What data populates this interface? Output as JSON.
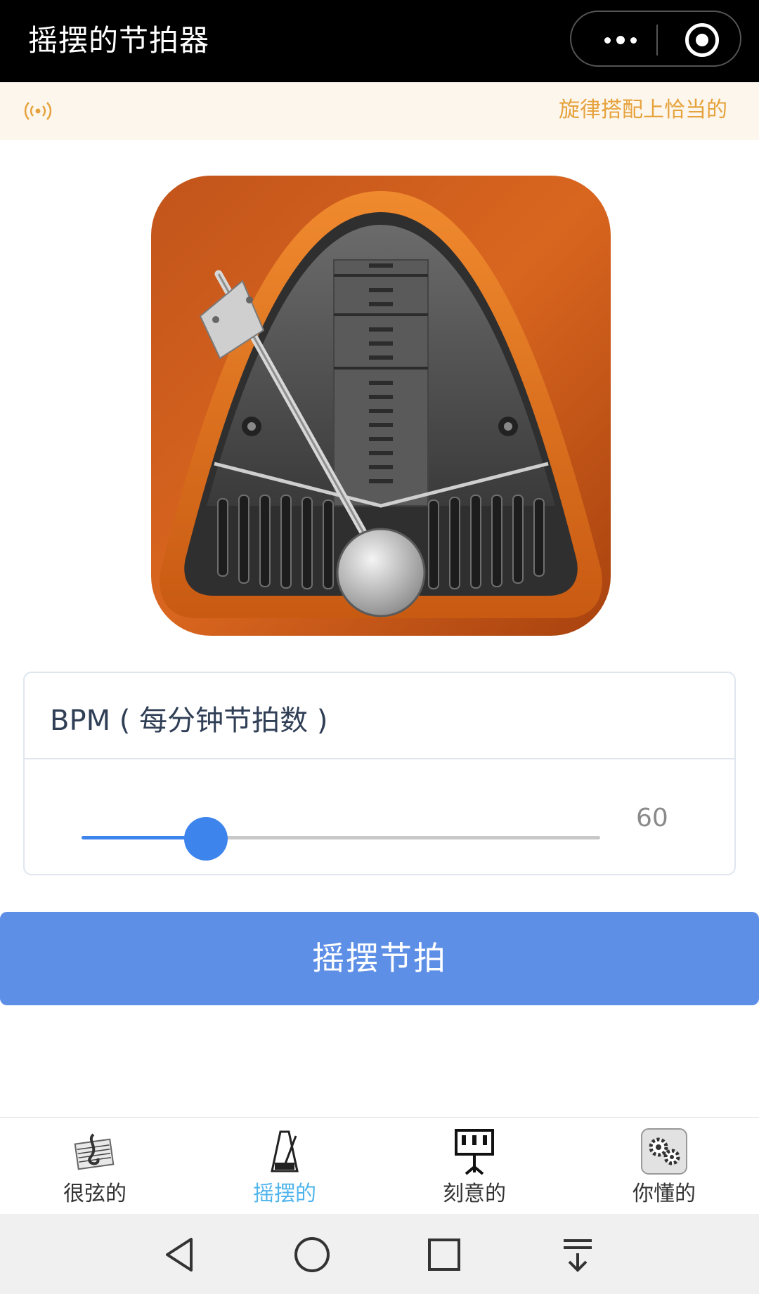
{
  "header": {
    "title": "摇摆的节拍器",
    "more_icon": "more-dots-icon",
    "close_icon": "target-circle-icon"
  },
  "notice": {
    "icon": "broadcast-icon",
    "text": "旋律搭配上恰当的",
    "color": "#e6a23c"
  },
  "hero": {
    "image": "metronome-app-icon"
  },
  "bpm": {
    "label": "BPM ( 每分钟节拍数 )",
    "value": "60",
    "slider_fraction": 0.24,
    "accent": "#3e84ed"
  },
  "primary_button": {
    "label": "摇摆节拍",
    "color": "#5e8fe6"
  },
  "tabs": [
    {
      "label": "很弦的",
      "icon": "sheet-music-icon",
      "active": false
    },
    {
      "label": "摇摆的",
      "icon": "metronome-icon",
      "active": true
    },
    {
      "label": "刻意的",
      "icon": "music-stand-icon",
      "active": false
    },
    {
      "label": "你懂的",
      "icon": "gears-icon",
      "active": false
    }
  ],
  "system_nav": {
    "back_icon": "back-triangle-icon",
    "home_icon": "home-circle-icon",
    "recents_icon": "recents-square-icon",
    "notifications_icon": "pull-down-icon"
  }
}
